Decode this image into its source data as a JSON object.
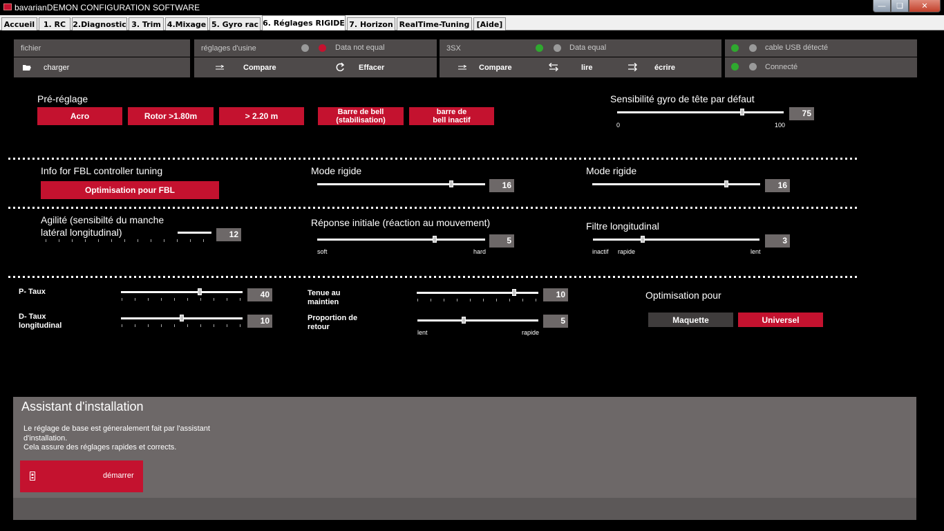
{
  "window": {
    "title": "bavarianDEMON CONFIGURATION SOFTWARE"
  },
  "tabs": [
    "Accueil",
    "1. RC",
    "2.Diagnostic",
    "3. Trim",
    "4.Mixage",
    "5. Gyro rac",
    "6. Réglages RIGIDE",
    "7. Horizon",
    "RealTime-Tuning",
    "[Aide]"
  ],
  "active_tab": "6. Réglages RIGIDE",
  "header": {
    "file": {
      "title": "fichier",
      "load": "charger"
    },
    "factory": {
      "title": "réglages d'usine",
      "status": "Data not equal",
      "compare": "Compare",
      "erase": "Effacer"
    },
    "model": {
      "title": "3SX",
      "status": "Data equal",
      "compare": "Compare",
      "read": "lire",
      "write": "écrire"
    },
    "usb": {
      "detected": "cable USB détecté",
      "connected": "Connecté"
    }
  },
  "preset": {
    "title": "Pré-réglage",
    "buttons": [
      "Acro",
      "Rotor >1.80m",
      "> 2.20 m",
      "Barre de bell (stabilisation)",
      "barre de bell inactif"
    ]
  },
  "gyro_default": {
    "title": "Sensibilité gyro de tête par défaut",
    "min": "0",
    "max": "100",
    "value": "75",
    "level": 0.75
  },
  "fbl": {
    "title": "Info for FBL controller tuning",
    "button": "Optimisation pour FBL"
  },
  "mode_rigide_1": {
    "title": "Mode rigide",
    "value": "16",
    "level": 0.8
  },
  "mode_rigide_2": {
    "title": "Mode rigide",
    "value": "16",
    "level": 0.8
  },
  "agility": {
    "title_line1": "Agilité (sensibilté du manche",
    "title_line2": "latéral  longitudinal)",
    "value": "12",
    "level": 1.0
  },
  "response": {
    "title": "Réponse initiale (réaction au mouvement)",
    "min": "soft",
    "max": "hard",
    "value": "5",
    "level": 0.7
  },
  "filter": {
    "title": "Filtre longitudinal",
    "min": "inactif",
    "mid": "rapide",
    "max": "lent",
    "value": "3",
    "level": 0.3
  },
  "p_rate": {
    "label": "P- Taux",
    "value": "40",
    "level": 0.65
  },
  "d_rate": {
    "label_line1": "D- Taux",
    "label_line2": "longitudinal",
    "value": "10",
    "level": 0.5
  },
  "hold": {
    "label_line1": "Tenue au",
    "label_line2": "maintien",
    "value": "10",
    "level": 0.8
  },
  "return_ratio": {
    "label_line1": "Proportion de",
    "label_line2": "retour",
    "min": "lent",
    "max": "rapide",
    "value": "5",
    "level": 0.38
  },
  "optimise": {
    "title": "Optimisation pour",
    "opt1": "Maquette",
    "opt2": "Universel"
  },
  "assistant": {
    "title": "Assistant d'installation",
    "text_line1": "Le réglage de base est géneralement fait par l'assistant",
    "text_line2": "d'installation.",
    "text_line3": "Cela assure des réglages rapides et corrects.",
    "start": "démarrer"
  },
  "colors": {
    "accent": "#c4122f",
    "panel": "#4e4a4a",
    "led_green": "#2fa92f",
    "led_grey": "#9a9a9a"
  }
}
